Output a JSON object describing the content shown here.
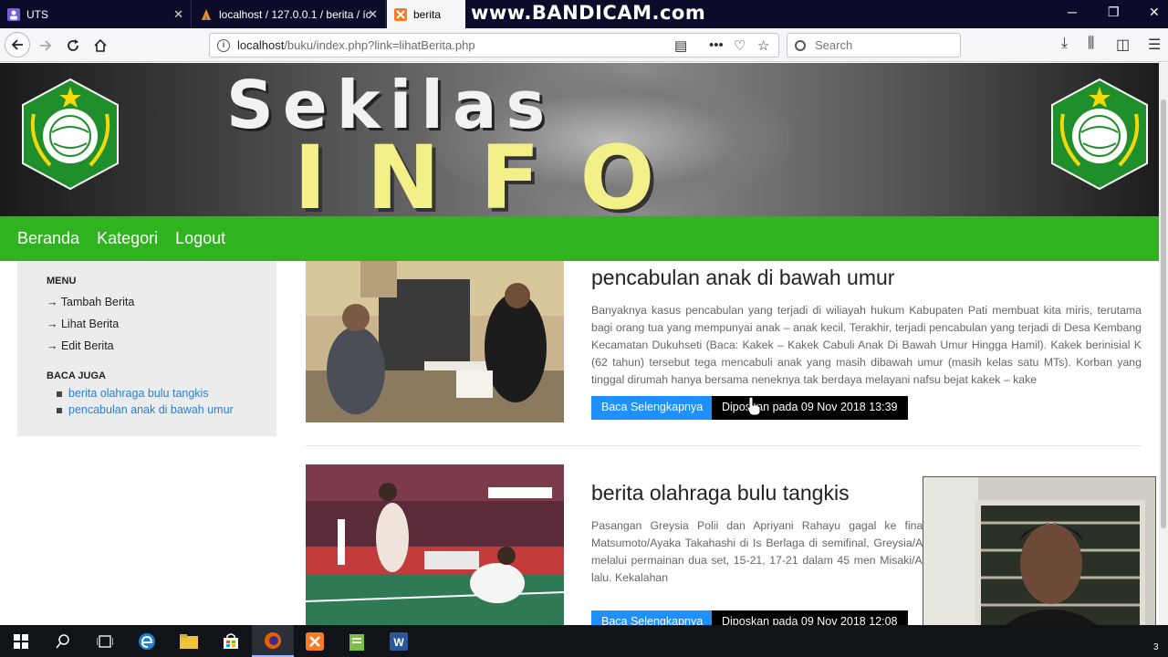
{
  "browser": {
    "tabs": [
      {
        "label": "UTS",
        "active": false
      },
      {
        "label": "localhost / 127.0.0.1 / berita / íc",
        "active": false
      },
      {
        "label": "berita",
        "active": true
      }
    ],
    "watermark": "www.BANDICAM.com",
    "url": {
      "host": "localhost",
      "path": "/buku/index.php?link=lihatBerita.php"
    },
    "search_placeholder": "Search"
  },
  "site": {
    "banner_line1": "Sekilas",
    "banner_line2": "INFO",
    "brand_color": "#2fb31f",
    "nav": [
      "Beranda",
      "Kategori",
      "Logout"
    ]
  },
  "sidebar": {
    "menu_heading": "MENU",
    "menu_links": [
      "→ Tambah Berita",
      "→ Lihat Berita",
      "→ Edit Berita"
    ],
    "related_heading": "BACA JUGA",
    "related_links": [
      "berita olahraga bulu tangkis",
      "pencabulan anak di bawah umur"
    ]
  },
  "posts": [
    {
      "title": "pencabulan anak di bawah umur",
      "excerpt": "Banyaknya kasus pencabulan yang terjadi di wiliayah hukum Kabupaten Pati membuat kita miris, terutama bagi orang tua yang mempunyai anak – anak kecil. Terakhir, terjadi pencabulan yang terjadi di Desa Kembang Kecamatan Dukuhseti (Baca: Kakek – Kakek Cabuli Anak Di Bawah Umur Hingga Hamil). Kakek berinisial K (62 tahun) tersebut tega mencabuli anak yang masih dibawah umur (masih kelas satu MTs). Korban yang tinggal dirumah hanya bersama neneknya tak berdaya melayani nafsu bejat kakek – kake",
      "read_more": "Baca Selengkapnya",
      "posted": "Diposkan pada 09 Nov 2018 13:39"
    },
    {
      "title": "berita olahraga bulu tangkis",
      "excerpt": "Pasangan Greysia Polii dan Apriyani Rahayu gagal ke final bulut dikalahkan wakil Jepang, Misaki Matsumoto/Ayaka Takahashi di Is Berlaga di semifinal, Greysia/Apriyani harus mengakui keunggular setelah melalui permainan dua set, 15-21, 17-21 dalam 45 men Misaki/Ayaka di final Thailand Open 2018 pada Juli lalu. Kekalahan",
      "read_more": "Baca Selengkapnya",
      "posted": "Diposkan pada 09 Nov 2018 12:08"
    }
  ],
  "taskbar": {
    "tray_text": "3"
  }
}
